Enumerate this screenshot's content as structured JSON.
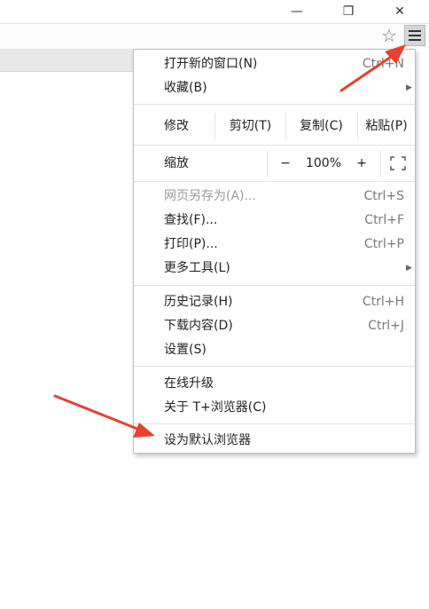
{
  "window": {
    "minimize_glyph": "—",
    "maximize_glyph": "❐",
    "close_glyph": "✕"
  },
  "toolbar": {
    "bookmark_icon": "star-outline",
    "menu_icon": "hamburger"
  },
  "menu": {
    "section1": [
      {
        "label": "打开新的窗口(N)",
        "shortcut": "Ctrl+N"
      },
      {
        "label": "收藏(B)",
        "submenu": true
      }
    ],
    "edit": {
      "modify": "修改",
      "cut": "剪切(T)",
      "copy": "复制(C)",
      "paste": "粘贴(P)"
    },
    "zoom": {
      "label": "缩放",
      "minus": "−",
      "value": "100%",
      "plus": "+",
      "fullscreen_icon": "fullscreen-corners"
    },
    "section3": [
      {
        "label": "网页另存为(A)...",
        "shortcut": "Ctrl+S",
        "disabled": true
      },
      {
        "label": "查找(F)...",
        "shortcut": "Ctrl+F"
      },
      {
        "label": "打印(P)...",
        "shortcut": "Ctrl+P"
      },
      {
        "label": "更多工具(L)",
        "submenu": true
      }
    ],
    "section4": [
      {
        "label": "历史记录(H)",
        "shortcut": "Ctrl+H"
      },
      {
        "label": "下载内容(D)",
        "shortcut": "Ctrl+J"
      },
      {
        "label": "设置(S)"
      }
    ],
    "section5": [
      {
        "label": "在线升级"
      },
      {
        "label": "关于 T+浏览器(C)"
      }
    ],
    "section6": [
      {
        "label": "设为默认浏览器"
      }
    ]
  },
  "colors": {
    "annotation_arrow": "#e8412f"
  }
}
